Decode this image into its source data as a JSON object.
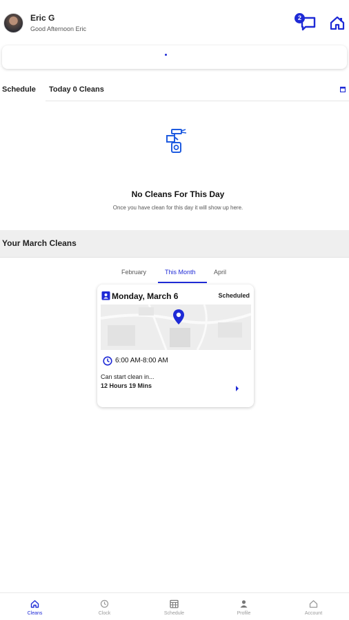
{
  "header": {
    "user_name": "Eric G",
    "greeting": "Good Afternoon Eric",
    "message_badge": "2",
    "icons": [
      "avatar",
      "chat-icon",
      "home-icon"
    ]
  },
  "schedule": {
    "label": "Schedule",
    "today_summary": "Today 0 Cleans",
    "empty_title": "No Cleans For This Day",
    "empty_subtitle": "Once you have clean for this day it will show up here."
  },
  "month_section": {
    "title": "Your March Cleans",
    "tabs": [
      {
        "label": "February",
        "active": false
      },
      {
        "label": "This Month",
        "active": true
      },
      {
        "label": "April",
        "active": false
      }
    ]
  },
  "clean_card": {
    "date": "Monday, March 6",
    "status": "Scheduled",
    "time": "6:00 AM-8:00 AM",
    "start_label": "Can start clean in...",
    "countdown": "12 Hours 19 Mins"
  },
  "bottom_nav": [
    {
      "label": "Cleans",
      "icon": "home-icon",
      "active": true
    },
    {
      "label": "Clock",
      "icon": "clock-icon",
      "active": false
    },
    {
      "label": "Schedule",
      "icon": "calendar-icon",
      "active": false
    },
    {
      "label": "Profile",
      "icon": "person-icon",
      "active": false
    },
    {
      "label": "Account",
      "icon": "house-icon",
      "active": false
    }
  ],
  "colors": {
    "accent": "#1e2ad6",
    "band": "#efefef",
    "muted": "#999999"
  }
}
